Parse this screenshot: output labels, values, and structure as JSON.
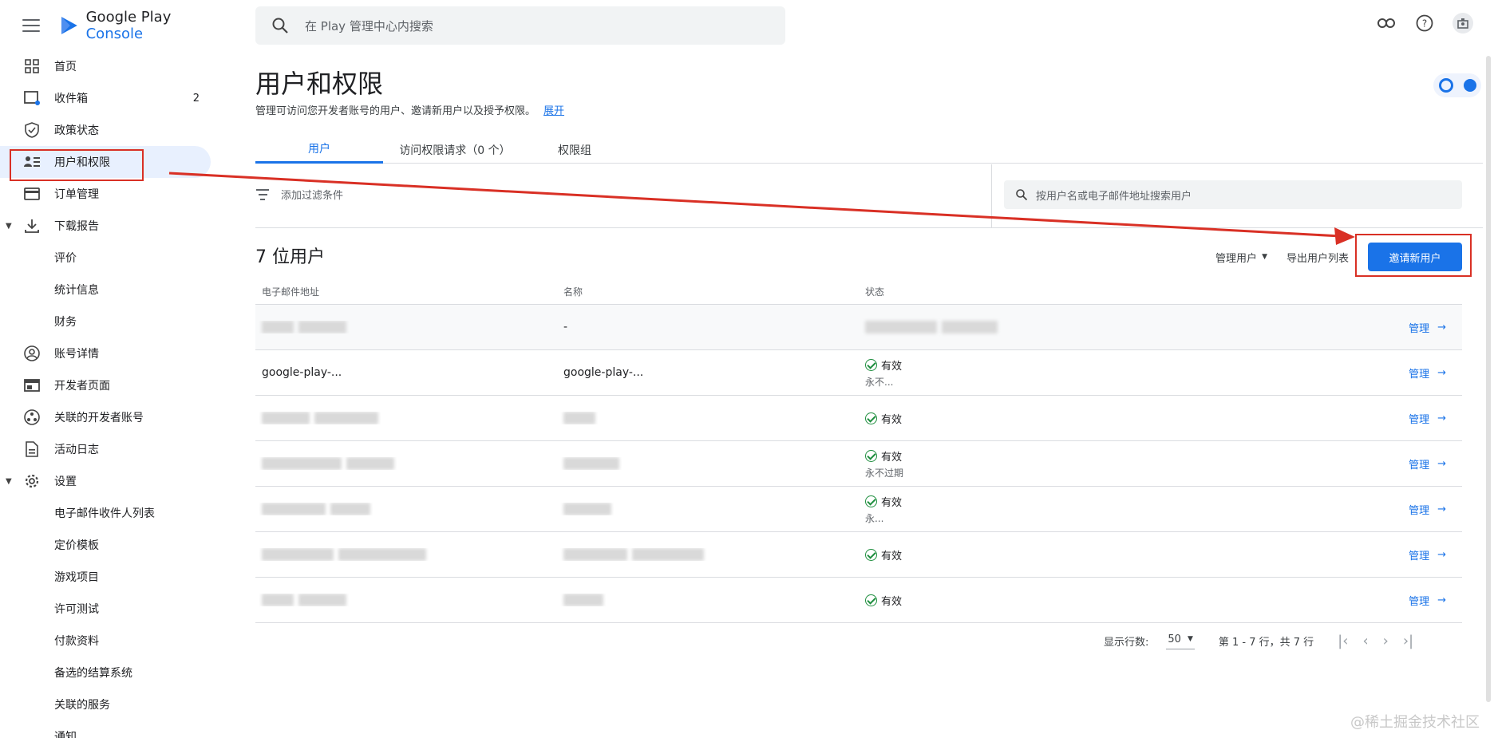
{
  "app": {
    "logo_text_google": "Google Play",
    "logo_text_console": "Console"
  },
  "sidebar": {
    "items": [
      {
        "label": "首页",
        "icon": "grid-icon"
      },
      {
        "label": "收件箱",
        "icon": "inbox-icon",
        "count": "2"
      },
      {
        "label": "政策状态",
        "icon": "shield-icon"
      },
      {
        "label": "用户和权限",
        "icon": "users-icon",
        "active": true
      },
      {
        "label": "订单管理",
        "icon": "credit-card-icon"
      },
      {
        "label": "下载报告",
        "icon": "download-icon",
        "expandable": true
      },
      {
        "label": "评价",
        "sub": true
      },
      {
        "label": "统计信息",
        "sub": true
      },
      {
        "label": "财务",
        "sub": true
      },
      {
        "label": "账号详情",
        "icon": "account-icon"
      },
      {
        "label": "开发者页面",
        "icon": "web-page-icon"
      },
      {
        "label": "关联的开发者账号",
        "icon": "linked-accounts-icon"
      },
      {
        "label": "活动日志",
        "icon": "document-icon"
      },
      {
        "label": "设置",
        "icon": "gear-icon",
        "expandable": true
      },
      {
        "label": "电子邮件收件人列表",
        "sub": true
      },
      {
        "label": "定价模板",
        "sub": true
      },
      {
        "label": "游戏项目",
        "sub": true
      },
      {
        "label": "许可测试",
        "sub": true
      },
      {
        "label": "付款资料",
        "sub": true
      },
      {
        "label": "备选的结算系统",
        "sub": true
      },
      {
        "label": "关联的服务",
        "sub": true
      },
      {
        "label": "通知",
        "sub": true
      }
    ]
  },
  "search": {
    "placeholder": "在 Play 管理中心内搜索"
  },
  "page": {
    "title": "用户和权限",
    "description": "管理可访问您开发者账号的用户、邀请新用户以及授予权限。",
    "expand_link": "展开"
  },
  "tabs": [
    {
      "label": "用户",
      "active": true
    },
    {
      "label": "访问权限请求（0 个）"
    },
    {
      "label": "权限组"
    }
  ],
  "filters": {
    "add_filter": "添加过滤条件",
    "user_search_placeholder": "按用户名或电子邮件地址搜索用户"
  },
  "users": {
    "count_title": "7 位用户",
    "manage_users": "管理用户",
    "export_list": "导出用户列表",
    "invite_button": "邀请新用户"
  },
  "table": {
    "headers": {
      "email": "电子邮件地址",
      "name": "名称",
      "status": "状态"
    },
    "rows": [
      {
        "email": "",
        "name": "-",
        "status": "",
        "status_sub": "",
        "manage": "管理"
      },
      {
        "email": "google-play-...",
        "name": "google-play-...",
        "status": "有效",
        "status_sub": "永不...",
        "manage": "管理"
      },
      {
        "email": "",
        "name": "",
        "status": "有效",
        "status_sub": "",
        "manage": "管理"
      },
      {
        "email": "",
        "name": "",
        "status": "有效",
        "status_sub": "永不过期",
        "manage": "管理"
      },
      {
        "email": "",
        "name": "",
        "status": "有效",
        "status_sub": "永...",
        "manage": "管理"
      },
      {
        "email": "",
        "name": "",
        "status": "有效",
        "status_sub": "",
        "manage": "管理"
      },
      {
        "email": "",
        "name": "",
        "status": "有效",
        "status_sub": "",
        "manage": "管理"
      }
    ]
  },
  "pagination": {
    "rows_label": "显示行数:",
    "rows_value": "50",
    "range": "第 1 - 7 行，共 7 行"
  },
  "watermark": "@稀土掘金技术社区",
  "colors": {
    "accent": "#1a73e8",
    "annotation_red": "#d93025",
    "success_green": "#1e8e3e"
  }
}
